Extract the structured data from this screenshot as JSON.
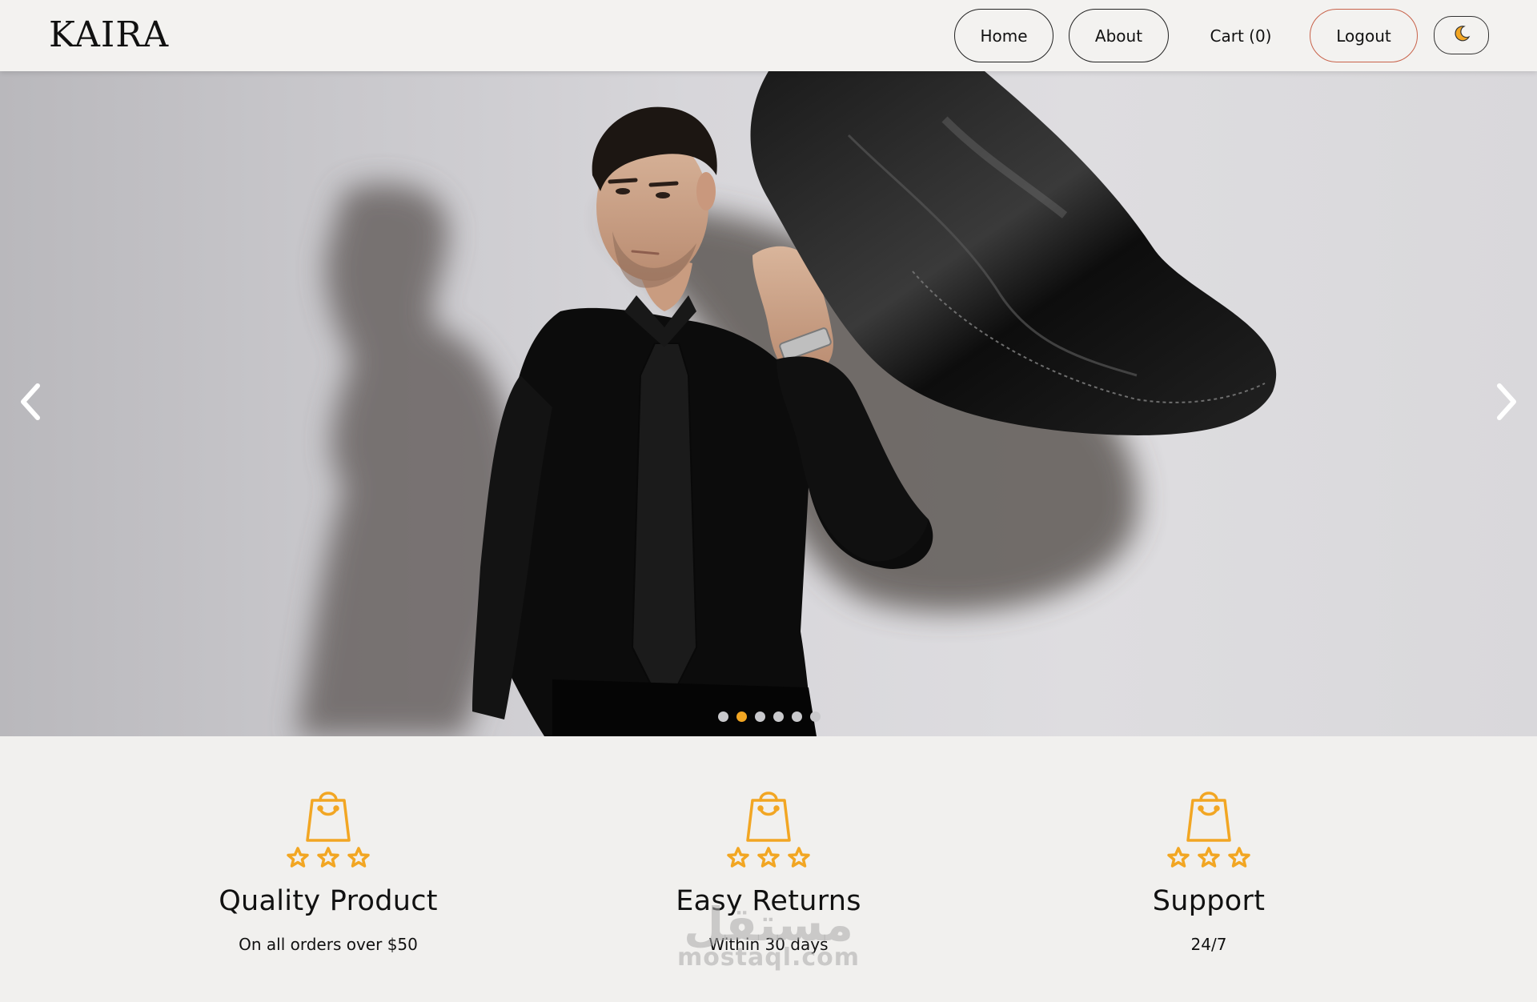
{
  "navbar": {
    "logo": "KAIRA",
    "home_label": "Home",
    "about_label": "About",
    "cart_label": "Cart (0)",
    "logout_label": "Logout",
    "theme_icon": "moon-icon"
  },
  "hero": {
    "slide_count": 6,
    "active_slide": 2,
    "prev_icon": "chevron-left-icon",
    "next_icon": "chevron-right-icon"
  },
  "features": [
    {
      "icon": "shopping-bag-stars-icon",
      "title": "Quality Product",
      "subtitle": "On all orders over $50"
    },
    {
      "icon": "shopping-bag-stars-icon",
      "title": "Easy Returns",
      "subtitle": "Within 30 days"
    },
    {
      "icon": "shopping-bag-stars-icon",
      "title": "Support",
      "subtitle": "24/7"
    }
  ],
  "watermark": {
    "arabic": "مستقل",
    "latin": "mostaql.com"
  },
  "colors": {
    "accent": "#f2a623",
    "logout_border": "#c8624a",
    "page_bg": "#f1f0ee"
  }
}
